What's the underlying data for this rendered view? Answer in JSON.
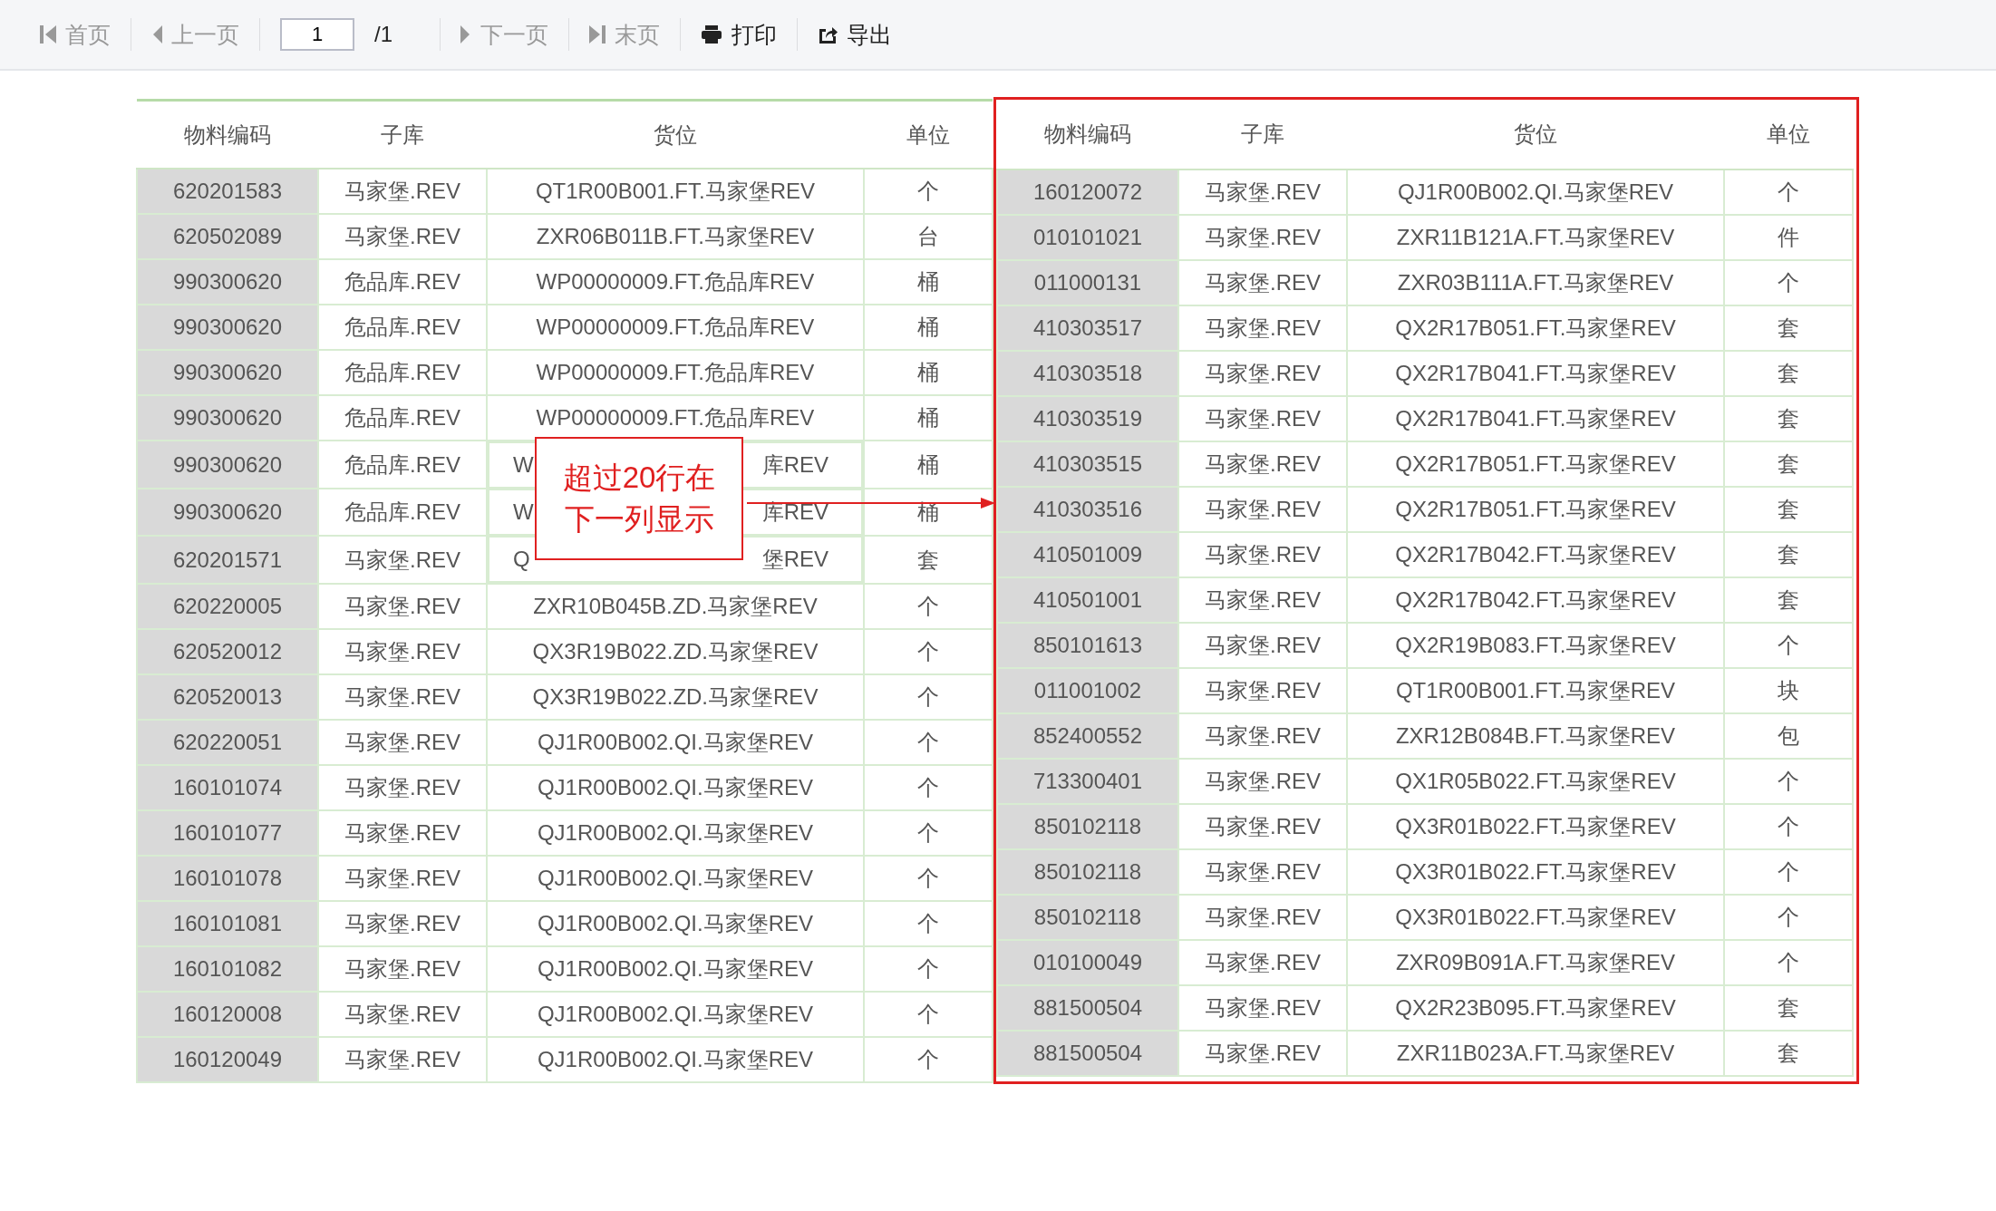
{
  "toolbar": {
    "items": [
      {
        "kind": "first",
        "label": "首页",
        "disabled": true
      },
      {
        "kind": "prev",
        "label": "上一页",
        "disabled": true
      },
      {
        "kind": "page",
        "value": "1",
        "total": "/1"
      },
      {
        "kind": "next",
        "label": "下一页",
        "disabled": true
      },
      {
        "kind": "last",
        "label": "末页",
        "disabled": true
      },
      {
        "kind": "print",
        "label": "打印",
        "disabled": false
      },
      {
        "kind": "export",
        "label": "导出",
        "disabled": false
      }
    ]
  },
  "table": {
    "blocks": [
      {
        "highlighted": false,
        "columns": [
          "物料编码",
          "子库",
          "货位",
          "单位"
        ],
        "rows": [
          [
            "620201583",
            "马家堡.REV",
            "QT1R00B001.FT.马家堡REV",
            "个"
          ],
          [
            "620502089",
            "马家堡.REV",
            "ZXR06B011B.FT.马家堡REV",
            "台"
          ],
          [
            "990300620",
            "危品库.REV",
            "WP00000009.FT.危品库REV",
            "桶"
          ],
          [
            "990300620",
            "危品库.REV",
            "WP00000009.FT.危品库REV",
            "桶"
          ],
          [
            "990300620",
            "危品库.REV",
            "WP00000009.FT.危品库REV",
            "桶"
          ],
          [
            "990300620",
            "危品库.REV",
            "WP00000009.FT.危品库REV",
            "桶"
          ],
          [
            "990300620",
            "危品库.REV",
            {
              "visible_start": "W",
              "visible_end": "库REV"
            },
            "桶"
          ],
          [
            "990300620",
            "危品库.REV",
            {
              "visible_start": "W",
              "visible_end": "库REV"
            },
            "桶"
          ],
          [
            "620201571",
            "马家堡.REV",
            {
              "visible_start": "Q",
              "visible_end": "堡REV"
            },
            "套"
          ],
          [
            "620220005",
            "马家堡.REV",
            "ZXR10B045B.ZD.马家堡REV",
            "个"
          ],
          [
            "620520012",
            "马家堡.REV",
            "QX3R19B022.ZD.马家堡REV",
            "个"
          ],
          [
            "620520013",
            "马家堡.REV",
            "QX3R19B022.ZD.马家堡REV",
            "个"
          ],
          [
            "620220051",
            "马家堡.REV",
            "QJ1R00B002.QI.马家堡REV",
            "个"
          ],
          [
            "160101074",
            "马家堡.REV",
            "QJ1R00B002.QI.马家堡REV",
            "个"
          ],
          [
            "160101077",
            "马家堡.REV",
            "QJ1R00B002.QI.马家堡REV",
            "个"
          ],
          [
            "160101078",
            "马家堡.REV",
            "QJ1R00B002.QI.马家堡REV",
            "个"
          ],
          [
            "160101081",
            "马家堡.REV",
            "QJ1R00B002.QI.马家堡REV",
            "个"
          ],
          [
            "160101082",
            "马家堡.REV",
            "QJ1R00B002.QI.马家堡REV",
            "个"
          ],
          [
            "160120008",
            "马家堡.REV",
            "QJ1R00B002.QI.马家堡REV",
            "个"
          ],
          [
            "160120049",
            "马家堡.REV",
            "QJ1R00B002.QI.马家堡REV",
            "个"
          ]
        ]
      },
      {
        "highlighted": true,
        "columns": [
          "物料编码",
          "子库",
          "货位",
          "单位"
        ],
        "rows": [
          [
            "160120072",
            "马家堡.REV",
            "QJ1R00B002.QI.马家堡REV",
            "个"
          ],
          [
            "010101021",
            "马家堡.REV",
            "ZXR11B121A.FT.马家堡REV",
            "件"
          ],
          [
            "011000131",
            "马家堡.REV",
            "ZXR03B111A.FT.马家堡REV",
            "个"
          ],
          [
            "410303517",
            "马家堡.REV",
            "QX2R17B051.FT.马家堡REV",
            "套"
          ],
          [
            "410303518",
            "马家堡.REV",
            "QX2R17B041.FT.马家堡REV",
            "套"
          ],
          [
            "410303519",
            "马家堡.REV",
            "QX2R17B041.FT.马家堡REV",
            "套"
          ],
          [
            "410303515",
            "马家堡.REV",
            "QX2R17B051.FT.马家堡REV",
            "套"
          ],
          [
            "410303516",
            "马家堡.REV",
            "QX2R17B051.FT.马家堡REV",
            "套"
          ],
          [
            "410501009",
            "马家堡.REV",
            "QX2R17B042.FT.马家堡REV",
            "套"
          ],
          [
            "410501001",
            "马家堡.REV",
            "QX2R17B042.FT.马家堡REV",
            "套"
          ],
          [
            "850101613",
            "马家堡.REV",
            "QX2R19B083.FT.马家堡REV",
            "个"
          ],
          [
            "011001002",
            "马家堡.REV",
            "QT1R00B001.FT.马家堡REV",
            "块"
          ],
          [
            "852400552",
            "马家堡.REV",
            "ZXR12B084B.FT.马家堡REV",
            "包"
          ],
          [
            "713300401",
            "马家堡.REV",
            "QX1R05B022.FT.马家堡REV",
            "个"
          ],
          [
            "850102118",
            "马家堡.REV",
            "QX3R01B022.FT.马家堡REV",
            "个"
          ],
          [
            "850102118",
            "马家堡.REV",
            "QX3R01B022.FT.马家堡REV",
            "个"
          ],
          [
            "850102118",
            "马家堡.REV",
            "QX3R01B022.FT.马家堡REV",
            "个"
          ],
          [
            "010100049",
            "马家堡.REV",
            "ZXR09B091A.FT.马家堡REV",
            "个"
          ],
          [
            "881500504",
            "马家堡.REV",
            "QX2R23B095.FT.马家堡REV",
            "套"
          ],
          [
            "881500504",
            "马家堡.REV",
            "ZXR11B023A.FT.马家堡REV",
            "套"
          ]
        ]
      }
    ]
  },
  "annotation": {
    "lines": [
      "超过20行在",
      "下一列显示"
    ]
  }
}
